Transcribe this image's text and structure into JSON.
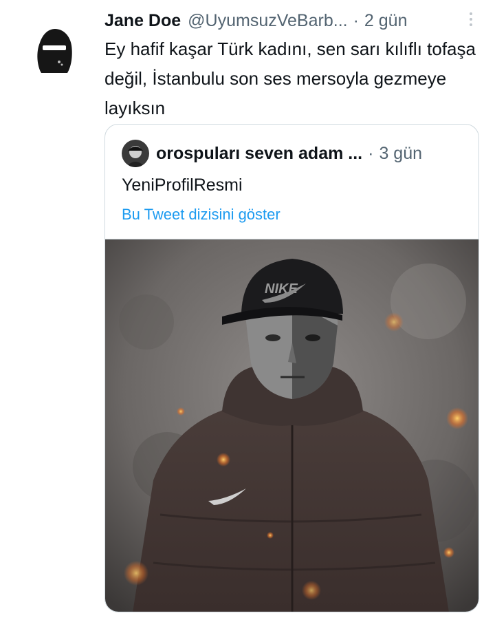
{
  "tweet": {
    "author_name": "Jane Doe",
    "author_handle": "@UyumsuzVeBarb...",
    "separator": "·",
    "time": "2 gün",
    "text": "Ey hafif kaşar Türk kadını, sen sarı kılıflı tofaşa değil, İstanbulu son ses mersoyla gezmeye layıksın",
    "more_icon": "more-vertical-icon",
    "avatar_icon": "hooded-figure-avatar"
  },
  "quoted": {
    "author_name": "orospuları seven adam ...",
    "separator": "·",
    "time": "3 gün",
    "text": "YeniProfilResmi",
    "thread_link": "Bu Tweet dizisini göster",
    "logo_cap": "NIKE",
    "link_color": "#1d9bf0"
  }
}
